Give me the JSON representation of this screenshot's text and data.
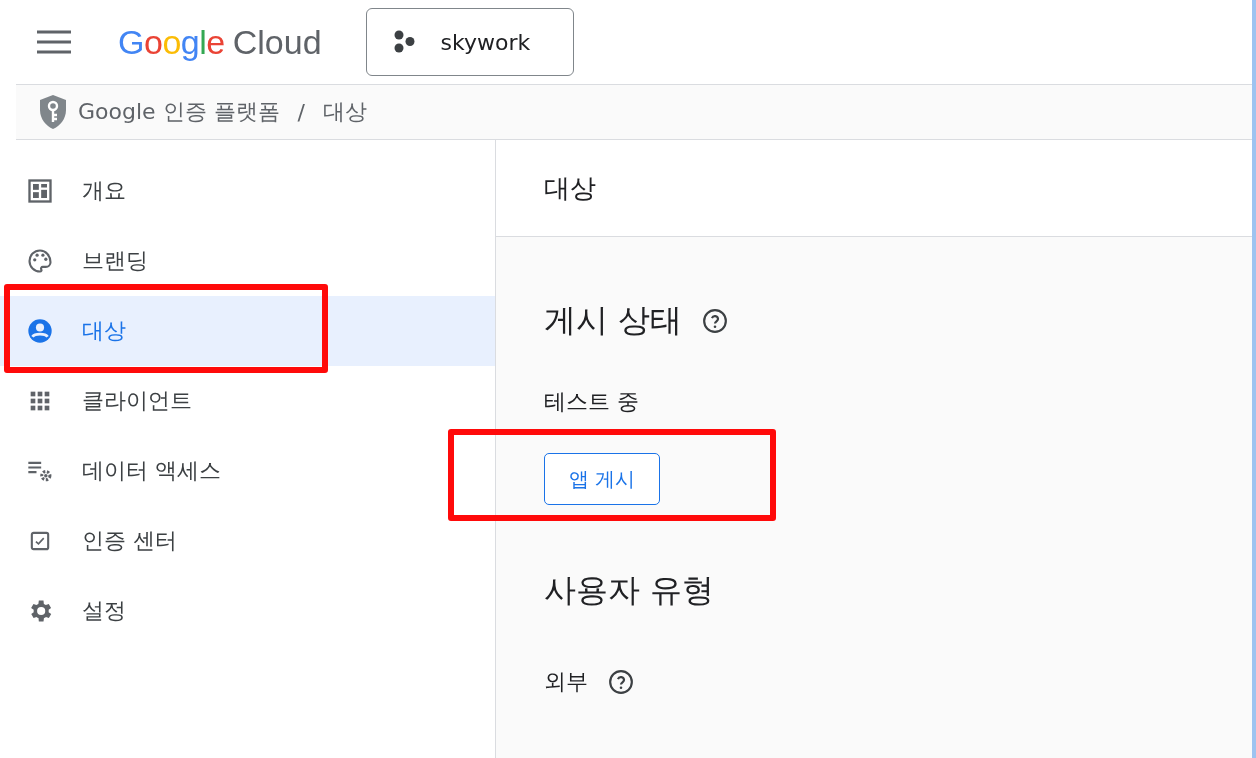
{
  "header": {
    "brand": "Google",
    "product": "Cloud",
    "project": "skywork"
  },
  "breadcrumb": {
    "items": [
      "Google 인증 플랫폼",
      "대상"
    ],
    "separator": "/"
  },
  "sidebar": {
    "items": [
      {
        "label": "개요",
        "kind": "dashboard",
        "selected": false,
        "highlighted": false
      },
      {
        "label": "브랜딩",
        "kind": "palette",
        "selected": false,
        "highlighted": false
      },
      {
        "label": "대상",
        "kind": "person",
        "selected": true,
        "highlighted": true
      },
      {
        "label": "클라이언트",
        "kind": "grid",
        "selected": false,
        "highlighted": false
      },
      {
        "label": "데이터 액세스",
        "kind": "list-gear",
        "selected": false,
        "highlighted": false
      },
      {
        "label": "인증 센터",
        "kind": "checkbox",
        "selected": false,
        "highlighted": false
      },
      {
        "label": "설정",
        "kind": "gear",
        "selected": false,
        "highlighted": false
      }
    ]
  },
  "content": {
    "title": "대상",
    "publishing": {
      "heading": "게시 상태",
      "status": "테스트 중",
      "button": "앱 게시",
      "highlighted": true
    },
    "user_type": {
      "heading": "사용자 유형",
      "value": "외부"
    }
  }
}
